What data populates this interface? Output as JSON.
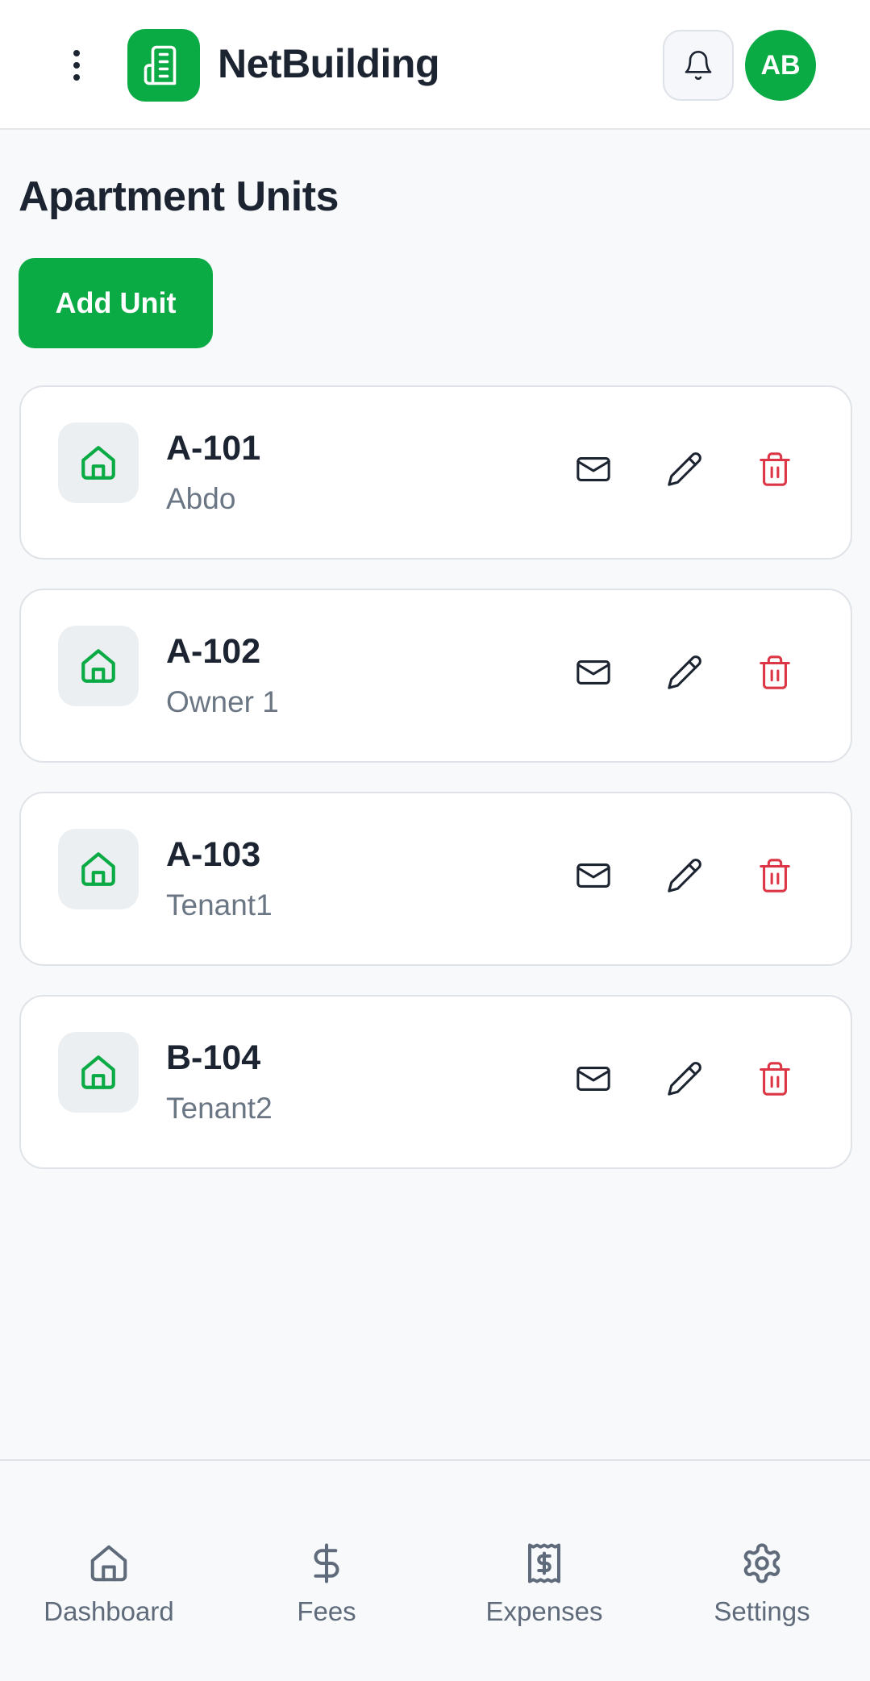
{
  "header": {
    "app_title": "NetBuilding",
    "avatar_initials": "AB",
    "icons": {
      "menu": "more-vertical-icon",
      "logo": "building-icon",
      "notifications": "bell-icon"
    }
  },
  "page": {
    "title": "Apartment Units",
    "add_button_label": "Add Unit"
  },
  "units": [
    {
      "name": "A-101",
      "owner": "Abdo"
    },
    {
      "name": "A-102",
      "owner": "Owner 1"
    },
    {
      "name": "A-103",
      "owner": "Tenant1"
    },
    {
      "name": "B-104",
      "owner": "Tenant2"
    }
  ],
  "unit_actions": [
    "mail-icon",
    "edit-icon",
    "trash-icon"
  ],
  "bottom_nav": [
    {
      "label": "Dashboard",
      "icon": "home-icon"
    },
    {
      "label": "Fees",
      "icon": "dollar-icon"
    },
    {
      "label": "Expenses",
      "icon": "receipt-icon"
    },
    {
      "label": "Settings",
      "icon": "gear-icon"
    }
  ],
  "colors": {
    "accent": "#0aaa44",
    "danger": "#dc3545",
    "text": "#1c2431",
    "muted": "#6b7684"
  }
}
